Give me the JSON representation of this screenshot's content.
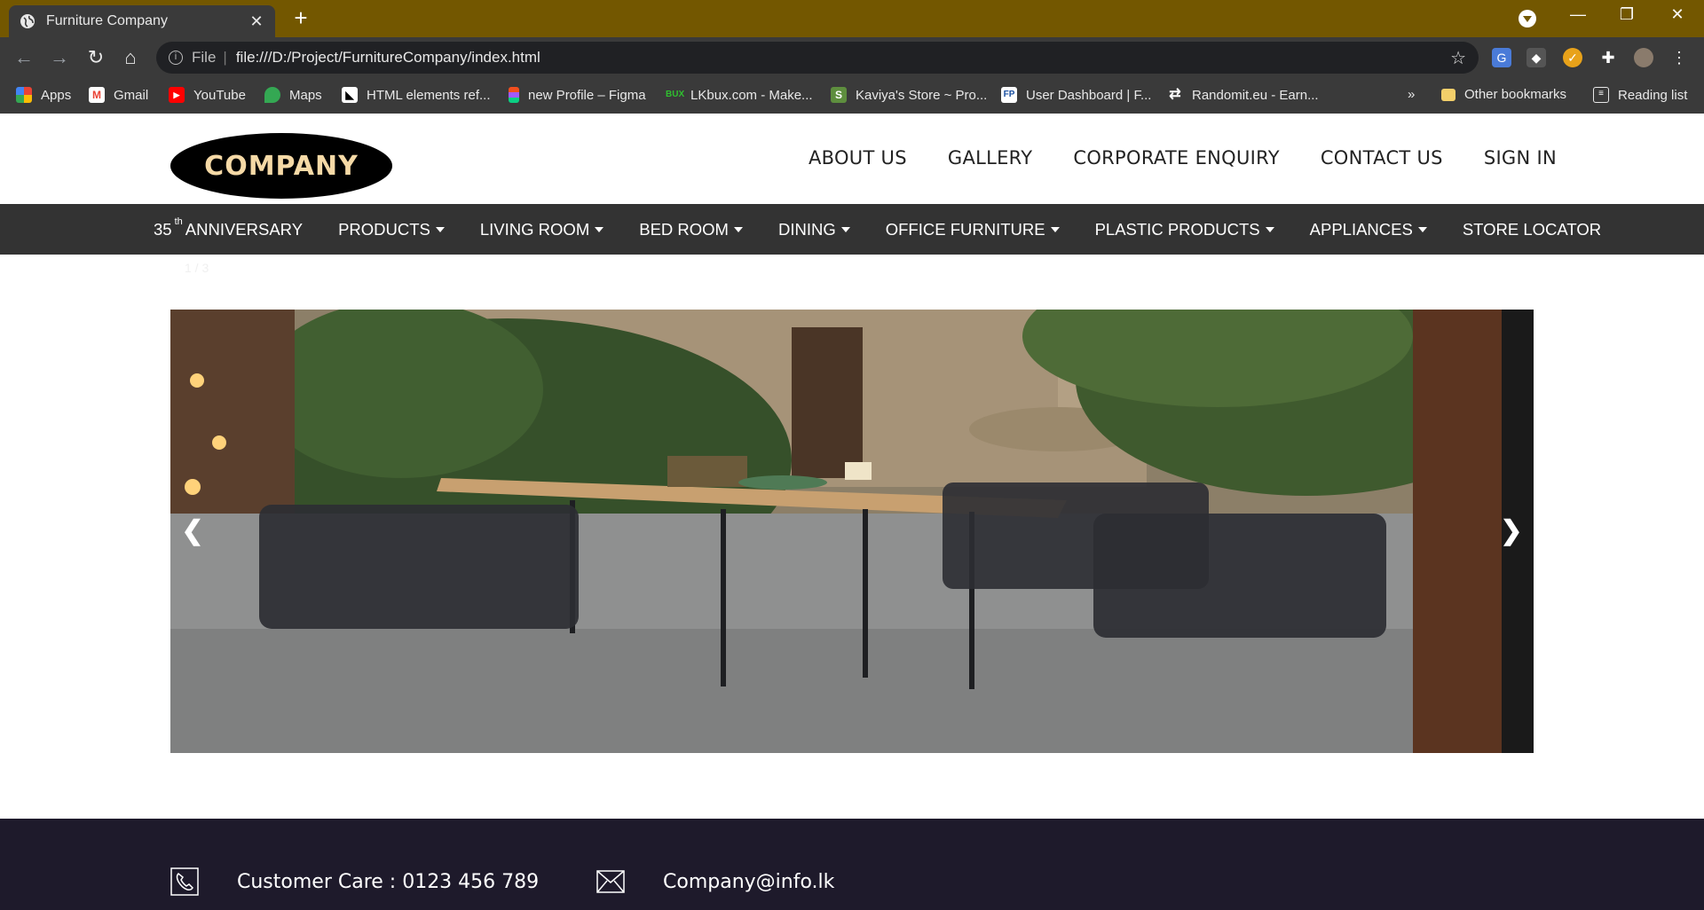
{
  "browser": {
    "tab_title": "Furniture Company",
    "url_scheme_label": "File",
    "url": "file:///D:/Project/FurnitureCompany/index.html",
    "bookmarks": [
      {
        "label": "Apps",
        "icon": "apps-grid-icon"
      },
      {
        "label": "Gmail",
        "icon": "gmail-icon"
      },
      {
        "label": "YouTube",
        "icon": "youtube-icon"
      },
      {
        "label": "Maps",
        "icon": "maps-icon"
      },
      {
        "label": "HTML elements ref...",
        "icon": "mdn-icon"
      },
      {
        "label": "new Profile – Figma",
        "icon": "figma-icon"
      },
      {
        "label": "LKbux.com - Make...",
        "icon": "lkbux-icon"
      },
      {
        "label": "Kaviya's Store ~ Pro...",
        "icon": "shopify-icon"
      },
      {
        "label": "User Dashboard | F...",
        "icon": "fp-icon"
      },
      {
        "label": "Randomit.eu - Earn...",
        "icon": "randomit-icon"
      }
    ],
    "overflow_label": "»",
    "other_bookmarks": "Other bookmarks",
    "reading_list": "Reading list"
  },
  "site": {
    "logo_text": "COMPANY",
    "top_links": [
      "ABOUT US",
      "GALLERY",
      "CORPORATE ENQUIRY",
      "CONTACT US",
      "SIGN IN"
    ],
    "nav": {
      "anniversary_num": "35",
      "anniversary_sup": "th",
      "anniversary_label": "ANNIVERSARY",
      "items": [
        {
          "label": "PRODUCTS",
          "dropdown": true
        },
        {
          "label": "LIVING ROOM",
          "dropdown": true
        },
        {
          "label": "BED ROOM",
          "dropdown": true
        },
        {
          "label": "DINING",
          "dropdown": true
        },
        {
          "label": "OFFICE FURNITURE",
          "dropdown": true
        },
        {
          "label": "PLASTIC PRODUCTS",
          "dropdown": true
        },
        {
          "label": "APPLIANCES",
          "dropdown": true
        },
        {
          "label": "STORE LOCATOR",
          "dropdown": false
        }
      ]
    },
    "slideshow": {
      "counter": "1 / 3",
      "prev_label": "❮",
      "next_label": "❯"
    },
    "footer": {
      "customer_care": "Customer Care : 0123 456 789",
      "email": "Company@info.lk"
    }
  },
  "colors": {
    "tabbar": "#735700",
    "nav_bg": "#333333",
    "footer_bg": "#1e1a2b",
    "logo_text": "#f5d9a6"
  }
}
